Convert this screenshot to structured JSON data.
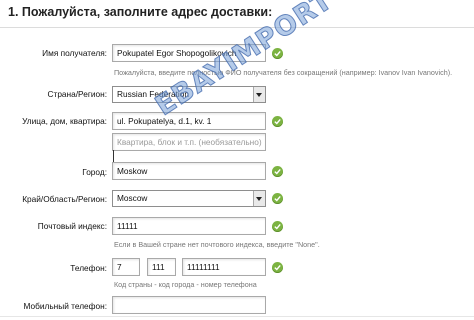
{
  "section": {
    "title": "1. Пожалуйста, заполните адрес доставки:"
  },
  "fields": {
    "recipient": {
      "label": "Имя получателя:",
      "value": "Pokupatel Egor Shopogolikovich",
      "hint": "Пожалуйста, введите полностью ФИО получателя без сокращений (например: Ivanov Ivan Ivanovich)."
    },
    "country": {
      "label": "Страна/Регион:",
      "value": "Russian Federation"
    },
    "street": {
      "label": "Улица, дом, квартира:",
      "value": "ul. Pokupatelya, d.1, kv. 1",
      "placeholder2": "Квартира, блок и т.п. (необязательно)"
    },
    "city": {
      "label": "Город:",
      "value": "Moskow"
    },
    "region": {
      "label": "Край/Область/Регион:",
      "value": "Moscow"
    },
    "postal": {
      "label": "Почтовый индекс:",
      "value": "11111",
      "hint": "Если в Вашей стране нет почтового индекса, введите \"None\"."
    },
    "phone": {
      "label": "Телефон:",
      "country_code": "7",
      "city_code": "111",
      "number": "11111111",
      "hint": "Код страны - код города - номер телефона"
    },
    "mobile": {
      "label": "Мобильный телефон:",
      "value": ""
    }
  },
  "watermark": "EBAYIMPORT",
  "colors": {
    "check": "#7cb342",
    "watermark": "#78a0d7"
  }
}
